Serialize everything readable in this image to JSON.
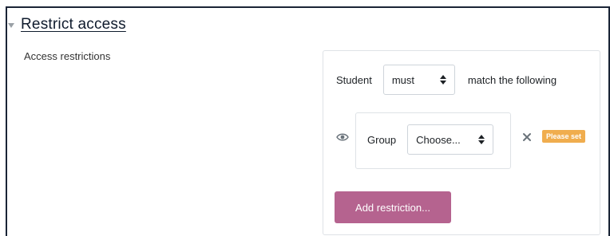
{
  "section": {
    "title": "Restrict access",
    "field_label": "Access restrictions"
  },
  "restriction": {
    "prefix": "Student",
    "match_select": {
      "selected": "must"
    },
    "suffix": "match the following",
    "condition": {
      "visibility_icon": "eye-icon",
      "type_label": "Group",
      "group_select": {
        "selected": "Choose..."
      },
      "remove_icon": "close-icon",
      "badge": "Please set"
    },
    "add_button": "Add restriction..."
  },
  "colors": {
    "accent": "#b5638f",
    "badge": "#f0ad4e",
    "frame": "#1a2436"
  }
}
